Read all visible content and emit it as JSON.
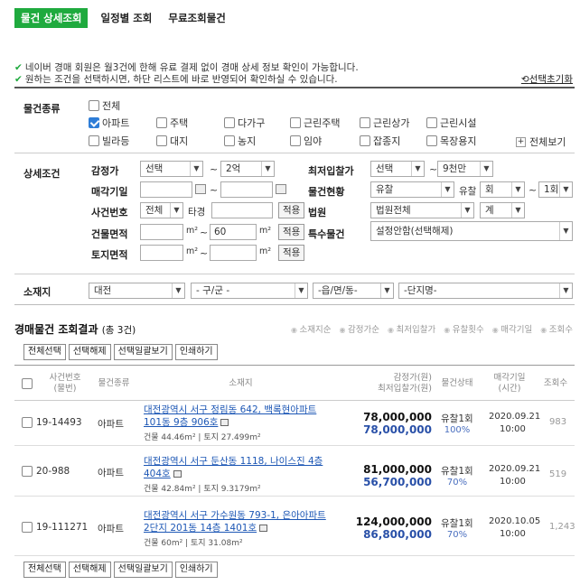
{
  "tabs": [
    "물건 상세조회",
    "일정별 조회",
    "무료조회물건"
  ],
  "notices": [
    "네이버 경매 회원은 월3건에 한해 유료 결제 없이 경매 상세 정보 확인이 가능합니다.",
    "원하는 조건을 선택하시면, 하단 리스트에 바로 반영되어 확인하실 수 있습니다."
  ],
  "reset_label": "선택초기화",
  "filters": {
    "type_label": "물건종류",
    "types": [
      "전체",
      "아파트",
      "주택",
      "다가구",
      "근린주택",
      "근린상가",
      "근린시설",
      "빌라등",
      "대지",
      "농지",
      "임야",
      "잡종지",
      "목장용지"
    ],
    "checked": "아파트",
    "view_all": "전체보기",
    "detail_label": "상세조건",
    "appraisal_label": "감정가",
    "appraisal_from": "선택",
    "appraisal_to": "2억",
    "min_bid_label": "최저입찰가",
    "min_bid_from": "선택",
    "min_bid_to": "9천만",
    "sale_date_label": "매각기일",
    "status_label": "물건현황",
    "status_value": "유찰",
    "fail_label": "유찰",
    "fail_from": "회",
    "fail_to": "1회",
    "case_label": "사건번호",
    "case_select": "전체",
    "case_type": "타경",
    "apply": "적용",
    "court_label": "법원",
    "court_value": "법원전체",
    "court_sub": "계",
    "building_label": "건물면적",
    "building_to": "60",
    "area_unit": "m²",
    "special_label": "특수물건",
    "special_value": "설정안함(선택해제)",
    "land_label": "토지면적",
    "location_label": "소재지",
    "loc_city": "대전",
    "loc_gu": "- 구/군 -",
    "loc_dong": "-읍/면/동-",
    "loc_complex": "-단지명-"
  },
  "results": {
    "title": "경매물건 조회결과",
    "count": "(총 3건)",
    "sorts": [
      "소재지순",
      "감정가순",
      "최저입찰가",
      "유찰횟수",
      "매각기일",
      "조회수"
    ],
    "actions": [
      "전체선택",
      "선택해제",
      "선택일괄보기",
      "인쇄하기"
    ],
    "headers": {
      "case": [
        "사건번호",
        "(물번)"
      ],
      "type": "물건종류",
      "addr": "소재지",
      "price": [
        "감정가(원)",
        "최저입찰가(원)"
      ],
      "status": "물건상태",
      "date": [
        "매각기일",
        "(시간)"
      ],
      "views": "조회수"
    },
    "rows": [
      {
        "case": "19-14493",
        "type": "아파트",
        "addr1": "대전광역시 서구 정림동 642, 백록현아파트",
        "addr2": "101동 9층 906호",
        "area": "건물 44.46m² | 토지 27.499m²",
        "appraisal": "78,000,000",
        "min": "78,000,000",
        "status": "유찰1회",
        "pct": "100%",
        "date": "2020.09.21",
        "time": "10:00",
        "views": "983"
      },
      {
        "case": "20-988",
        "type": "아파트",
        "addr1": "대전광역시 서구 둔산동 1118, 나이스진 4층",
        "addr2": "404호",
        "area": "건물 42.84m² | 토지 9.3179m²",
        "appraisal": "81,000,000",
        "min": "56,700,000",
        "status": "유찰1회",
        "pct": "70%",
        "date": "2020.09.21",
        "time": "10:00",
        "views": "519"
      },
      {
        "case": "19-111271",
        "type": "아파트",
        "addr1": "대전광역시 서구 가수원동 793-1, 은아아파트",
        "addr2": "2단지 201동 14층 1401호",
        "area": "건물 60m² | 토지 31.08m²",
        "appraisal": "124,000,000",
        "min": "86,800,000",
        "status": "유찰1회",
        "pct": "70%",
        "date": "2020.10.05",
        "time": "10:00",
        "views": "1,243"
      }
    ]
  }
}
